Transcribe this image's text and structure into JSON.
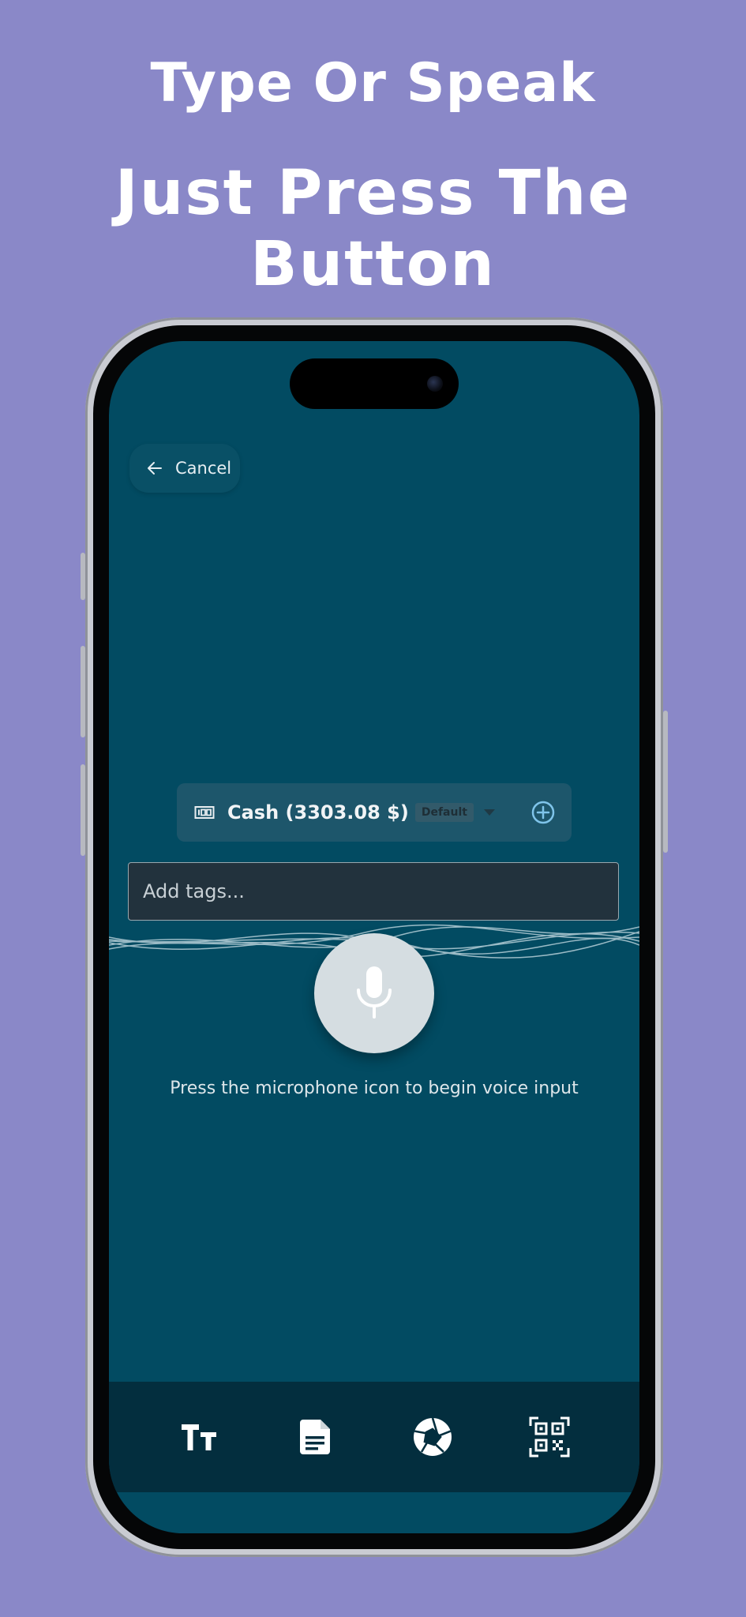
{
  "headline": {
    "line1": "Type Or Speak",
    "line2": "Just Press The Button"
  },
  "topbar": {
    "cancel_label": "Cancel",
    "cancel_icon": "arrow-left-icon"
  },
  "account": {
    "name": "Cash (3303.08 $)",
    "badge": "Default",
    "icon": "cash-icon",
    "dropdown_icon": "caret-down-icon",
    "add_icon": "plus-circle-icon"
  },
  "tags": {
    "placeholder": "Add tags..."
  },
  "voice": {
    "mic_icon": "microphone-icon",
    "hint": "Press the microphone icon to begin voice input"
  },
  "toolbar": {
    "items": [
      {
        "name": "text-icon"
      },
      {
        "name": "document-icon"
      },
      {
        "name": "camera-shutter-icon"
      },
      {
        "name": "qr-scan-icon"
      }
    ]
  },
  "colors": {
    "background": "#8a88c8",
    "screen": "#024b62",
    "bottom_bar": "#032e3e",
    "accent": "#7fc4ea"
  }
}
